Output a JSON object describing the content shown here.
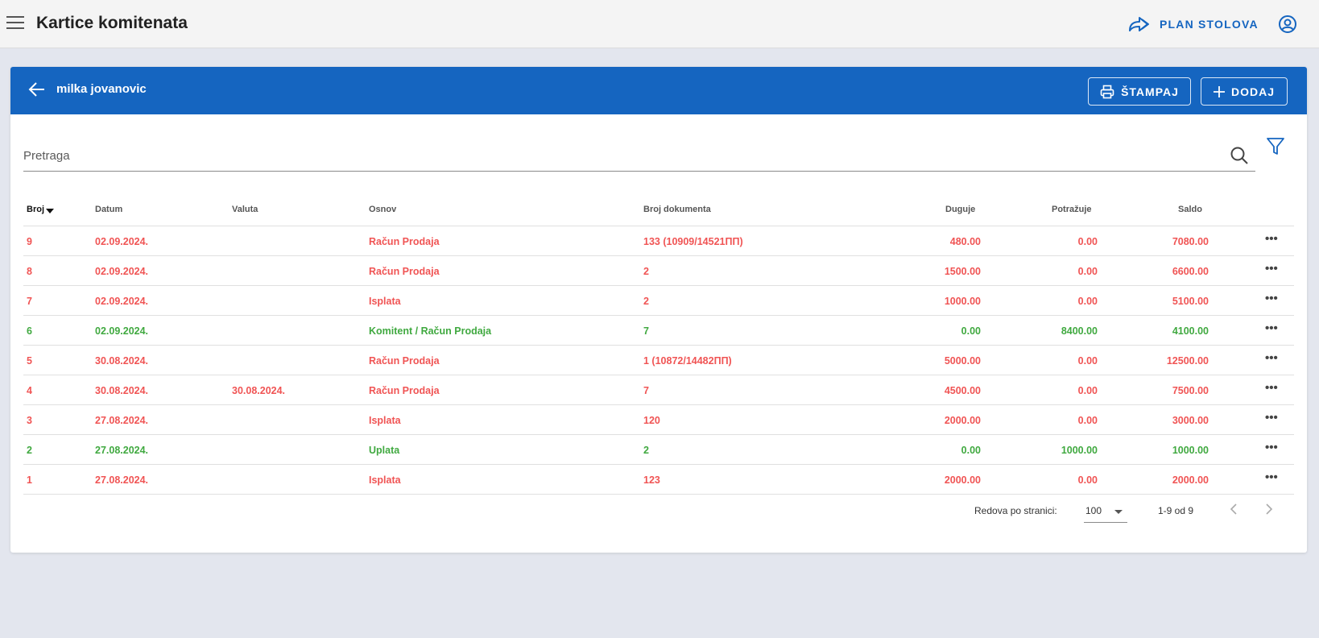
{
  "appbar": {
    "title": "Kartice komitenata",
    "plan_label": "PLAN STOLOVA"
  },
  "card": {
    "client_name": "milka jovanovic",
    "print_label": "ŠTAMPAJ",
    "add_label": "DODAJ"
  },
  "search": {
    "placeholder": "Pretraga"
  },
  "table": {
    "headers": {
      "broj": "Broj",
      "datum": "Datum",
      "valuta": "Valuta",
      "osnov": "Osnov",
      "broj_dokumenta": "Broj dokumenta",
      "duguje": "Duguje",
      "potrazuje": "Potražuje",
      "saldo": "Saldo"
    },
    "rows": [
      {
        "broj": "9",
        "datum": "02.09.2024.",
        "valuta": "",
        "osnov": "Račun Prodaja",
        "broj_dokumenta": "133 (10909/14521ПП)",
        "duguje": "480.00",
        "potrazuje": "0.00",
        "saldo": "7080.00",
        "status": "red"
      },
      {
        "broj": "8",
        "datum": "02.09.2024.",
        "valuta": "",
        "osnov": "Račun Prodaja",
        "broj_dokumenta": "2",
        "duguje": "1500.00",
        "potrazuje": "0.00",
        "saldo": "6600.00",
        "status": "red"
      },
      {
        "broj": "7",
        "datum": "02.09.2024.",
        "valuta": "",
        "osnov": "Isplata",
        "broj_dokumenta": "2",
        "duguje": "1000.00",
        "potrazuje": "0.00",
        "saldo": "5100.00",
        "status": "red"
      },
      {
        "broj": "6",
        "datum": "02.09.2024.",
        "valuta": "",
        "osnov": "Komitent / Račun Prodaja",
        "broj_dokumenta": "7",
        "duguje": "0.00",
        "potrazuje": "8400.00",
        "saldo": "4100.00",
        "status": "green"
      },
      {
        "broj": "5",
        "datum": "30.08.2024.",
        "valuta": "",
        "osnov": "Račun Prodaja",
        "broj_dokumenta": "1 (10872/14482ПП)",
        "duguje": "5000.00",
        "potrazuje": "0.00",
        "saldo": "12500.00",
        "status": "red"
      },
      {
        "broj": "4",
        "datum": "30.08.2024.",
        "valuta": "30.08.2024.",
        "osnov": "Račun Prodaja",
        "broj_dokumenta": "7",
        "duguje": "4500.00",
        "potrazuje": "0.00",
        "saldo": "7500.00",
        "status": "red"
      },
      {
        "broj": "3",
        "datum": "27.08.2024.",
        "valuta": "",
        "osnov": "Isplata",
        "broj_dokumenta": "120",
        "duguje": "2000.00",
        "potrazuje": "0.00",
        "saldo": "3000.00",
        "status": "red"
      },
      {
        "broj": "2",
        "datum": "27.08.2024.",
        "valuta": "",
        "osnov": "Uplata",
        "broj_dokumenta": "2",
        "duguje": "0.00",
        "potrazuje": "1000.00",
        "saldo": "1000.00",
        "status": "green"
      },
      {
        "broj": "1",
        "datum": "27.08.2024.",
        "valuta": "",
        "osnov": "Isplata",
        "broj_dokumenta": "123",
        "duguje": "2000.00",
        "potrazuje": "0.00",
        "saldo": "2000.00",
        "status": "red"
      }
    ]
  },
  "pagination": {
    "rows_label": "Redova po stranici:",
    "rows_per_page": "100",
    "range": "1-9 od 9"
  },
  "colors": {
    "primary": "#1565c0",
    "debit_red": "#f05454",
    "credit_green": "#40a940",
    "background": "#e3e6ee"
  },
  "icons": {
    "menu": "hamburger-icon",
    "plan": "forward-arrow-icon",
    "user": "account-circle-icon",
    "back": "arrow-left-icon",
    "print": "printer-icon",
    "add": "plus-icon",
    "search": "search-icon",
    "filter": "filter-icon",
    "row_menu": "more-horizontal-icon"
  }
}
